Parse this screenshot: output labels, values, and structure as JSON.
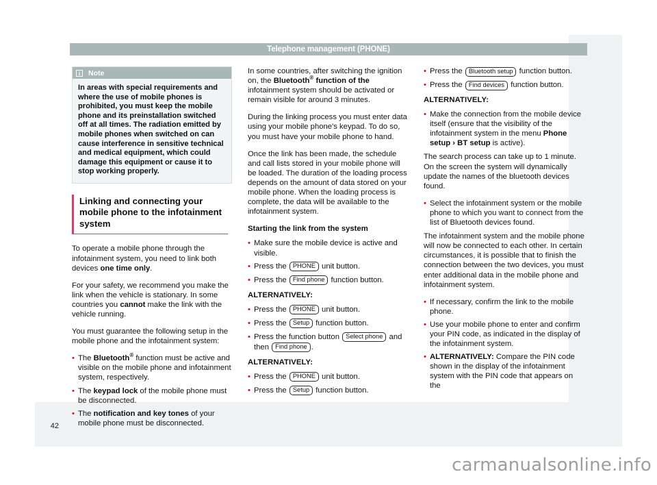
{
  "header": {
    "title": "Telephone management (PHONE)"
  },
  "page_number": "42",
  "watermark": "carmanualsonline.info",
  "note": {
    "icon": "info-icon",
    "icon_glyph": "i",
    "title": "Note",
    "text": "In areas with special requirements and where the use of mobile phones is prohibited, you must keep the mobile phone and its preinstallation switched off at all times. The radiation emitted by mobile phones when switched on can cause interference in sensitive technical and medical equipment, which could damage this equipment or cause it to stop working properly."
  },
  "section": {
    "heading": "Linking and connecting your mobile phone to the infotainment system"
  },
  "column1": {
    "p1_a": "To operate a mobile phone through the infotainment system, you need to link both devices ",
    "p1_b": "one time only",
    "p1_c": ".",
    "p2_a": "For your safety, we recommend you make the link when the vehicle is stationary. In some countries you ",
    "p2_b": "cannot",
    "p2_c": " make the link with the vehicle running.",
    "p3": "You must guarantee the following setup in the mobile phone and the infotainment system:",
    "b1_a": "The ",
    "b1_b": "Bluetooth",
    "b1_sup": "®",
    "b1_c": " function must be active and visible on the mobile phone and infotainment system, respectively.",
    "b2_a": "The ",
    "b2_b": "keypad lock",
    "b2_c": " of the mobile phone must be disconnected.",
    "b3_a": "The ",
    "b3_b": "notification and key tones",
    "b3_c": " of your mobile phone must be disconnected."
  },
  "column2": {
    "p1_a": "In some countries, after switching the ignition on, the ",
    "p1_b": "Bluetooth",
    "p1_sup": "®",
    "p1_c": " function of the",
    "p1_d": " infotainment system should be activated or remain visible for around 3 minutes.",
    "p2": "During the linking process you must enter data using your mobile phone's keypad. To do so, you must have your mobile phone to hand.",
    "p3": "Once the link has been made, the schedule and call lists stored in your mobile phone will be loaded. The duration of the loading process depends on the amount of data stored on your mobile phone. When the loading process is complete, the data will be available to the infotainment system.",
    "subhead": "Starting the link from the system",
    "b1": "Make sure the mobile device is active and visible.",
    "b2_a": "Press the ",
    "b2_key": "PHONE",
    "b2_b": " unit button.",
    "b3_a": "Press the ",
    "b3_key": "Find phone",
    "b3_b": " function button.",
    "alt1": "ALTERNATIVELY:",
    "b4_a": "Press the ",
    "b4_key": "PHONE",
    "b4_b": " unit button.",
    "b5_a": "Press the ",
    "b5_key": "Setup",
    "b5_b": " function button.",
    "b6_a": "Press the function button ",
    "b6_key1": "Select phone",
    "b6_b": " and then ",
    "b6_key2": "Find phone",
    "b6_c": ".",
    "alt2": "ALTERNATIVELY:",
    "b7_a": "Press the ",
    "b7_key": "PHONE",
    "b7_b": " unit button.",
    "b8_a": "Press the ",
    "b8_key": "Setup",
    "b8_b": " function button."
  },
  "column3": {
    "b1_a": "Press the ",
    "b1_key": "Bluetooth setup",
    "b1_b": " function button.",
    "b2_a": "Press the ",
    "b2_key": "Find devices",
    "b2_b": " function button.",
    "alt1": "ALTERNATIVELY:",
    "b3_a": "Make the connection from the mobile device itself (ensure that the visibility of the infotainment system in the menu ",
    "b3_b": "Phone setup ›",
    "b3_c": " ",
    "b3_d": "BT setup",
    "b3_e": " is active).",
    "p1": "The search process can take up to 1 minute. On the screen the system will dynamically update the names of the bluetooth devices found.",
    "b4": "Select the infotainment system or the mobile phone to which you want to connect from the list of Bluetooth devices found.",
    "p2": "The infotainment system and the mobile phone will now be connected to each other. In certain circumstances, it is possible that to finish the connection between the two devices, you must enter additional data in the mobile phone and infotainment system.",
    "b5": "If necessary, confirm the link to the mobile phone.",
    "b6": "Use your mobile phone to enter and confirm your PIN code, as indicated in the display of the infotainment system.",
    "b7_a": "ALTERNATIVELY:",
    "b7_b": " Compare the PIN code shown in the display of the infotainment system with the PIN code that appears on the"
  },
  "colors": {
    "header_bar": "#a9b7b7",
    "page_bg": "#eef2f2",
    "accent_pink": "#e8336d",
    "bullet_red": "#e3051b",
    "text": "#141414"
  }
}
